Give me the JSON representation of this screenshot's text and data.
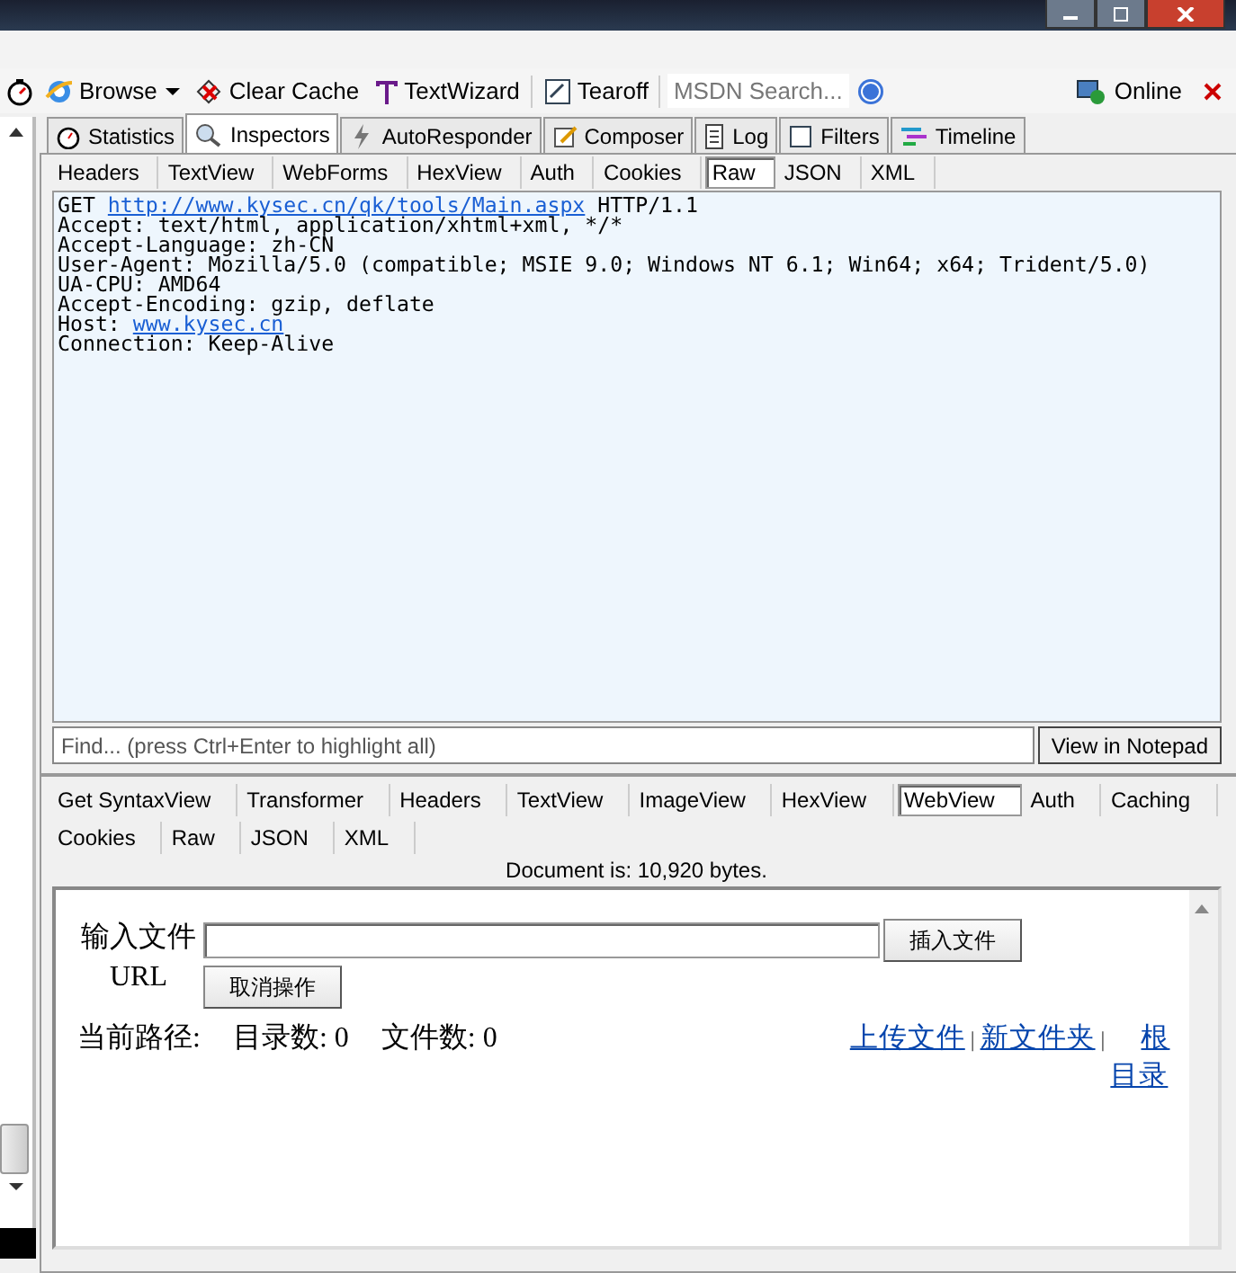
{
  "toolbar": {
    "items": [
      {
        "kind": "browse",
        "label": "Browse",
        "dropdown": true
      },
      {
        "kind": "clear",
        "label": "Clear Cache",
        "dropdown": false
      },
      {
        "kind": "wizard",
        "label": "TextWizard",
        "dropdown": false
      },
      {
        "kind": "tearoff",
        "label": "Tearoff",
        "dropdown": false
      }
    ],
    "search": {
      "placeholder": "MSDN Search..."
    },
    "online": "Online"
  },
  "inspector_tabs": [
    {
      "kind": "statistics",
      "label": "Statistics",
      "selected": false
    },
    {
      "kind": "inspectors",
      "label": "Inspectors",
      "selected": true
    },
    {
      "kind": "autoresponder",
      "label": "AutoResponder",
      "selected": false
    },
    {
      "kind": "composer",
      "label": "Composer",
      "selected": false
    },
    {
      "kind": "log",
      "label": "Log",
      "selected": false
    },
    {
      "kind": "filters",
      "label": "Filters",
      "selected": false
    },
    {
      "kind": "timeline",
      "label": "Timeline",
      "selected": false
    }
  ],
  "request_tabs": [
    {
      "label": "Headers",
      "selected": false
    },
    {
      "label": "TextView",
      "selected": false
    },
    {
      "label": "WebForms",
      "selected": false
    },
    {
      "label": "HexView",
      "selected": false
    },
    {
      "label": "Auth",
      "selected": false
    },
    {
      "label": "Cookies",
      "selected": false
    },
    {
      "label": "Raw",
      "selected": true
    },
    {
      "label": "JSON",
      "selected": false
    },
    {
      "label": "XML",
      "selected": false
    }
  ],
  "raw_lines": [
    [
      {
        "text": "GET ",
        "link": false
      },
      {
        "text": "http://www.kysec.cn/qk/tools/Main.aspx",
        "link": true
      },
      {
        "text": " HTTP/1.1",
        "link": false
      }
    ],
    [
      {
        "text": "Accept: text/html, application/xhtml+xml, */*",
        "link": false
      }
    ],
    [
      {
        "text": "Accept-Language: zh-CN",
        "link": false
      }
    ],
    [
      {
        "text": "User-Agent: Mozilla/5.0 (compatible; MSIE 9.0; Windows NT 6.1; Win64; x64; Trident/5.0)",
        "link": false
      }
    ],
    [
      {
        "text": "UA-CPU: AMD64",
        "link": false
      }
    ],
    [
      {
        "text": "Accept-Encoding: gzip, deflate",
        "link": false
      }
    ],
    [
      {
        "text": "Host: ",
        "link": false
      },
      {
        "text": "www.kysec.cn",
        "link": true
      }
    ],
    [
      {
        "text": "Connection: Keep-Alive",
        "link": false
      }
    ]
  ],
  "find": {
    "placeholder": "Find... (press Ctrl+Enter to highlight all)",
    "button": "View in Notepad"
  },
  "response_tab_rows": [
    [
      {
        "label": "Get SyntaxView",
        "selected": false
      },
      {
        "label": "Transformer",
        "selected": false
      },
      {
        "label": "Headers",
        "selected": false
      },
      {
        "label": "TextView",
        "selected": false
      },
      {
        "label": "ImageView",
        "selected": false
      },
      {
        "label": "HexView",
        "selected": false
      },
      {
        "label": "WebView",
        "selected": true
      },
      {
        "label": "Auth",
        "selected": false
      },
      {
        "label": "Caching",
        "selected": false
      }
    ],
    [
      {
        "label": "Cookies",
        "selected": false
      },
      {
        "label": "Raw",
        "selected": false
      },
      {
        "label": "JSON",
        "selected": false
      },
      {
        "label": "XML",
        "selected": false
      }
    ]
  ],
  "document_status": "Document is: 10,920 bytes.",
  "webview": {
    "file_label": "输入文件 URL",
    "insert_button": "插入文件",
    "cancel_button": "取消操作",
    "path_label": "当前路径:",
    "dir_count": "目录数: 0",
    "file_count": "文件数: 0",
    "links": [
      {
        "text": "上传文件",
        "kind": "link"
      },
      {
        "text": "|",
        "kind": "separator"
      },
      {
        "text": "新文件夹",
        "kind": "link"
      },
      {
        "text": "|",
        "kind": "separator"
      },
      {
        "text": "根目录",
        "kind": "link"
      }
    ]
  }
}
